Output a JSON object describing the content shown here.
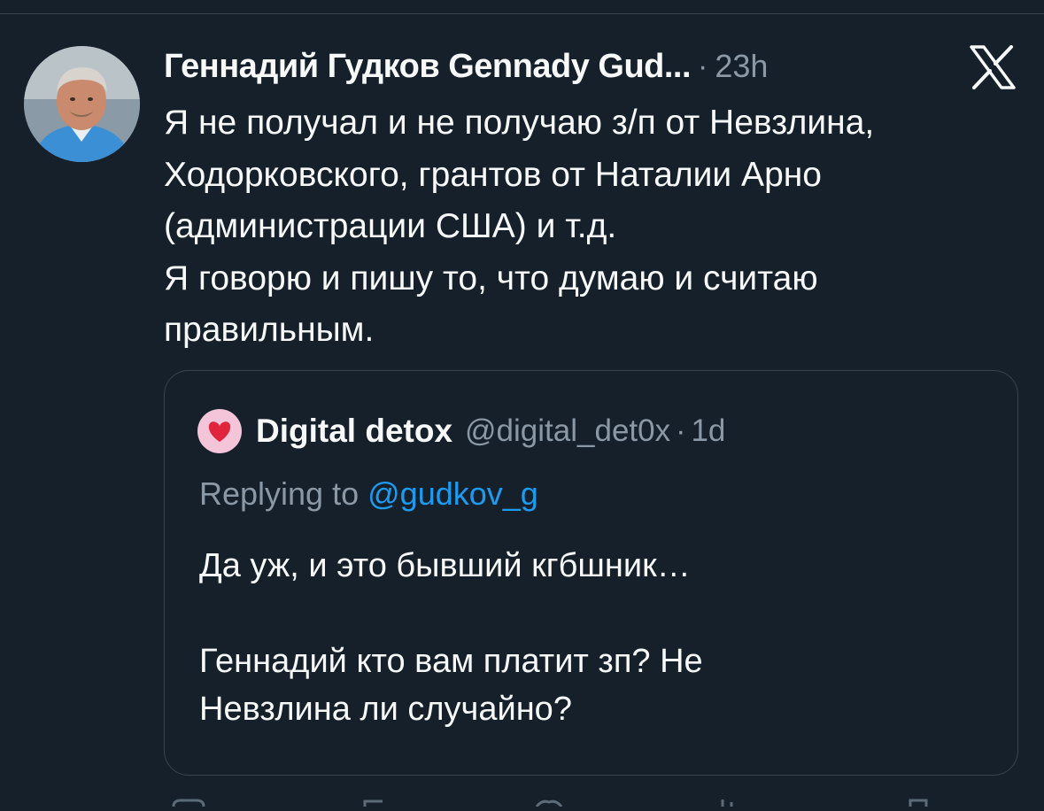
{
  "tweet": {
    "author": {
      "name": "Геннадий Гудков Gennady Gud...",
      "avatar_icon": "avatar-photo"
    },
    "separator": "·",
    "time": "23h",
    "platform_icon": "x-logo-icon",
    "text": "Я не получал и не получаю з/п от Невзлина,\nХодорковского, грантов от Наталии Арно\n(администрации США) и т.д.\nЯ говорю и пишу то, что думаю и считаю\nправильным."
  },
  "quote": {
    "avatar_icon": "heart-icon",
    "name": "Digital detox",
    "handle": "@digital_det0x",
    "separator": "·",
    "time": "1d",
    "replying_prefix": "Replying to",
    "replying_to": "@gudkov_g",
    "text": "Да уж, и это бывший кгбшник…\n\nГеннадий кто вам платит зп?  Не\nНевзлина ли случайно?"
  },
  "colors": {
    "background": "#15202b",
    "primary_text": "#f7f9f9",
    "secondary_text": "#8b98a5",
    "link": "#1d9bf0",
    "border": "#38444d"
  }
}
